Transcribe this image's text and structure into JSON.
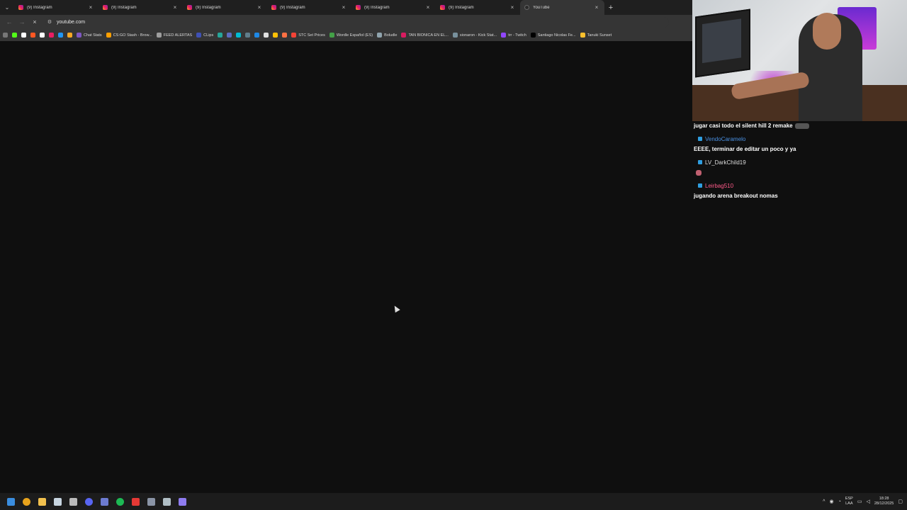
{
  "browser": {
    "tabs": [
      {
        "title": "(9) Instagram",
        "favicon": "instagram-icon",
        "active": false
      },
      {
        "title": "(9) Instagram",
        "favicon": "instagram-icon",
        "active": false
      },
      {
        "title": "(9) Instagram",
        "favicon": "instagram-icon",
        "active": false
      },
      {
        "title": "(9) Instagram",
        "favicon": "instagram-icon",
        "active": false
      },
      {
        "title": "(9) Instagram",
        "favicon": "instagram-icon",
        "active": false
      },
      {
        "title": "(9) Instagram",
        "favicon": "instagram-icon",
        "active": false
      },
      {
        "title": "YouTube",
        "favicon": "loading-icon",
        "active": true
      }
    ],
    "close_glyph": "×",
    "new_tab_glyph": "+",
    "address": "youtube.com",
    "bookmarks": [
      {
        "label": "",
        "color": "#53fc18"
      },
      {
        "label": "",
        "color": "#ffffff"
      },
      {
        "label": "",
        "color": "#ff5722"
      },
      {
        "label": "",
        "color": "#ffffff"
      },
      {
        "label": "",
        "color": "#e91e63"
      },
      {
        "label": "",
        "color": "#2196f3"
      },
      {
        "label": "",
        "color": "#f9a825"
      },
      {
        "label": "Chat Stats",
        "color": "#7e57c2"
      },
      {
        "label": "CS:GO Stash - Brow...",
        "color": "#ffa000"
      },
      {
        "label": "FEED ALERTAS",
        "color": "#9e9e9e"
      },
      {
        "label": "CLips",
        "color": "#3f51b5"
      },
      {
        "label": "",
        "color": "#26a69a"
      },
      {
        "label": "",
        "color": "#5c6bc0"
      },
      {
        "label": "",
        "color": "#00bcd4"
      },
      {
        "label": "",
        "color": "#607d8b"
      },
      {
        "label": "",
        "color": "#1e88e5"
      },
      {
        "label": "",
        "color": "#e0e0e0"
      },
      {
        "label": "",
        "color": "#ffc107"
      },
      {
        "label": "",
        "color": "#ff7043"
      },
      {
        "label": "STC Set Prices",
        "color": "#f44336"
      },
      {
        "label": "Wordle Español (ES)",
        "color": "#43a047"
      },
      {
        "label": "Boludle",
        "color": "#90a4ae"
      },
      {
        "label": "TAN BIONICA EN EL...",
        "color": "#d81b60"
      },
      {
        "label": "sionaron - Kick Stat...",
        "color": "#78909c"
      },
      {
        "label": "trr - Twitch",
        "color": "#9146ff"
      },
      {
        "label": "Santiago Nicolas Fe...",
        "color": "#000000"
      },
      {
        "label": "Tanuki Sunset",
        "color": "#fbc02d"
      }
    ]
  },
  "overlay": {
    "chat": [
      {
        "type": "msg",
        "text": "jugar casi todo el silent hill 2 remake"
      },
      {
        "type": "user",
        "name": "VendoCaramelo",
        "color": "#4a90e2"
      },
      {
        "type": "msg",
        "text": "EEEE, terminar de editar un poco y ya"
      },
      {
        "type": "user",
        "name": "LV_DarkChild19",
        "color": "#dddddd"
      },
      {
        "type": "msg",
        "text": ""
      },
      {
        "type": "user",
        "name": "Leirbag510",
        "color": "#ff5a8a"
      },
      {
        "type": "msg",
        "text": "jugando arena breakout nomas"
      }
    ]
  },
  "taskbar": {
    "apps": [
      {
        "name": "start-icon",
        "color": "#3a8dde"
      },
      {
        "name": "chrome-icon",
        "color": "#e8a31c"
      },
      {
        "name": "file-explorer-icon",
        "color": "#f2c14e"
      },
      {
        "name": "steam-icon",
        "color": "#c7d5e0"
      },
      {
        "name": "obs-icon",
        "color": "#bbbbbb"
      },
      {
        "name": "discord-icon",
        "color": "#5865f2"
      },
      {
        "name": "app-icon",
        "color": "#6c7bd0"
      },
      {
        "name": "spotify-icon",
        "color": "#1db954"
      },
      {
        "name": "app-icon-2",
        "color": "#e53935"
      },
      {
        "name": "app-icon-3",
        "color": "#8a94a6"
      },
      {
        "name": "app-icon-4",
        "color": "#b0bec5"
      },
      {
        "name": "app-icon-5",
        "color": "#8e7cf0"
      }
    ],
    "lang_top": "ESP",
    "lang_bottom": "LAA",
    "time": "18:28",
    "date": "28/12/2025"
  }
}
